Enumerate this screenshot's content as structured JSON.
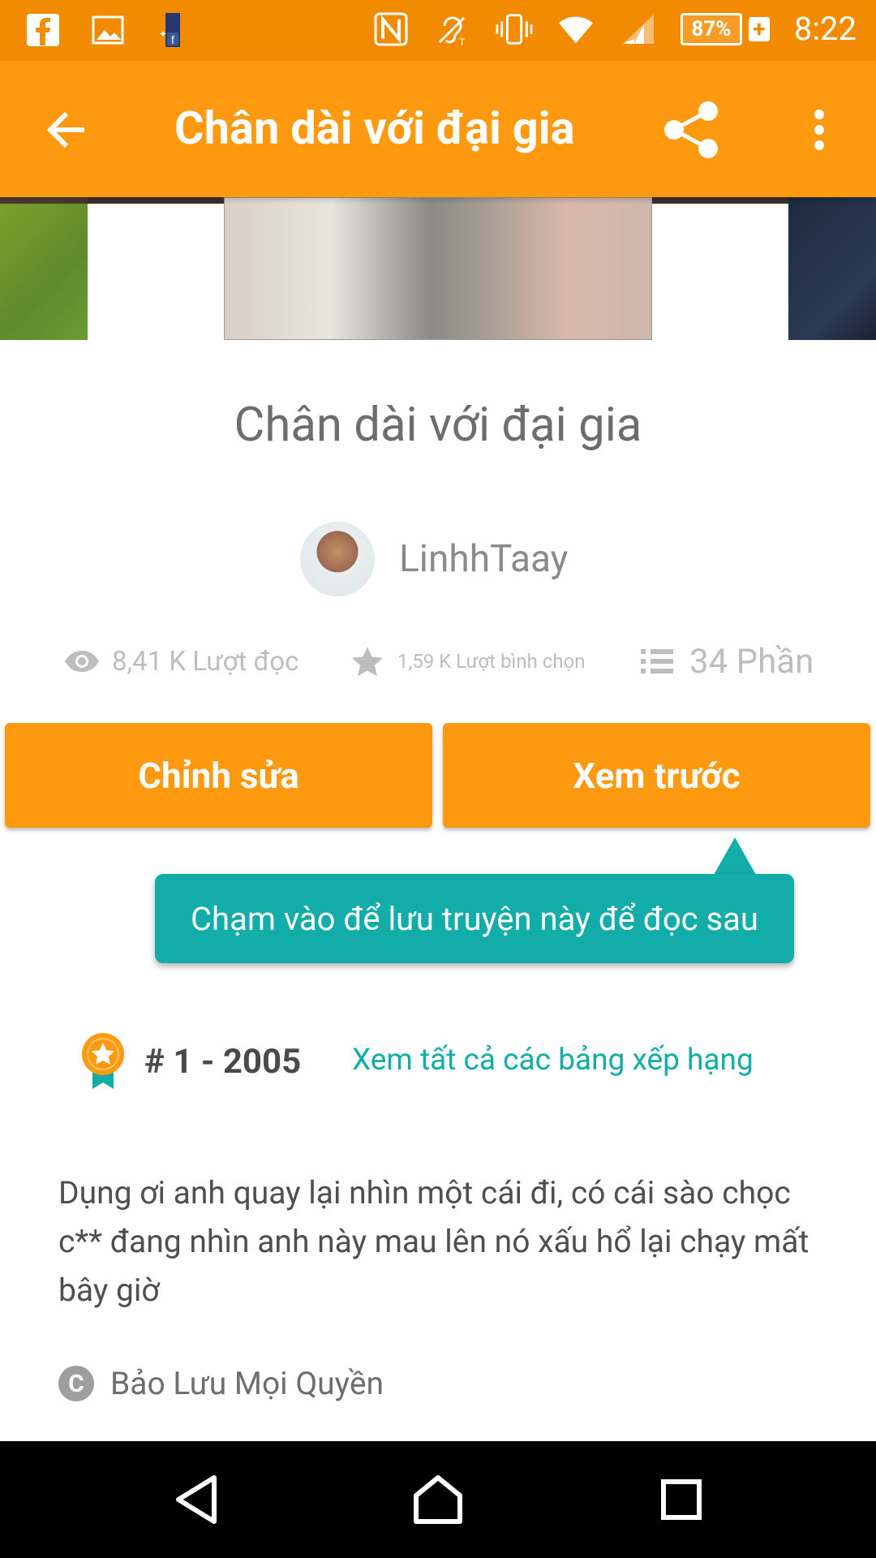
{
  "status_bar": {
    "battery_percent": "87%",
    "battery_plus": "+",
    "time": "8:22",
    "icons_left": [
      "facebook-icon",
      "gallery-icon",
      "facebook-thumbnail-icon"
    ],
    "icons_right": [
      "nfc-icon",
      "hearing-aid-icon",
      "vibrate-icon",
      "wifi-icon",
      "signal-icon",
      "battery-icon"
    ]
  },
  "app_bar": {
    "title": "Chân dài với đại gia",
    "background": "#FF9A10"
  },
  "story": {
    "title": "Chân dài với đại gia",
    "author": "LinhhTaay",
    "stats": {
      "reads": "8,41 K Lượt đọc",
      "votes": "1,59 K Lượt bình chọn",
      "parts": "34 Phần"
    }
  },
  "buttons": {
    "edit": "Chỉnh sửa",
    "preview": "Xem trước"
  },
  "tooltip": {
    "text": "Chạm vào để lưu truyện này để đọc sau",
    "color": "#12ADA8"
  },
  "ranking": {
    "rank": "# 1 - 2005",
    "link": "Xem tất cả các bảng xếp hạng"
  },
  "description": "Dụng ơi anh quay lại nhìn một cái đi, có cái sào chọc c** đang nhìn anh này mau lên nó xấu hổ lại chạy mất bây giờ",
  "copyright": {
    "icon_letter": "C",
    "text": "Bảo Lưu Mọi Quyền"
  },
  "colors": {
    "accent": "#FF9A10",
    "status_bar": "#F28B00",
    "teal": "#12ADA8"
  }
}
